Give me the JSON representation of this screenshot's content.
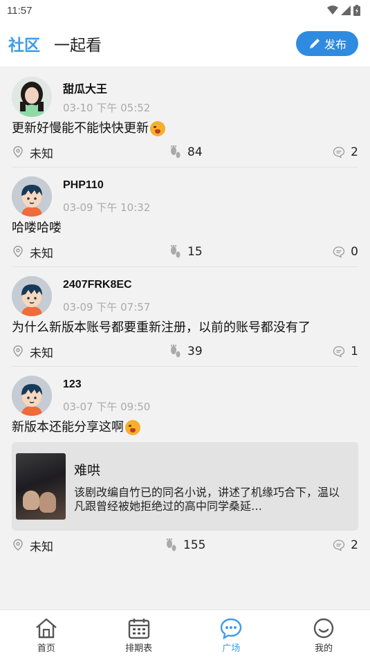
{
  "status_bar": {
    "time": "11:57"
  },
  "header": {
    "tabs": [
      {
        "label": "社区",
        "active": true
      },
      {
        "label": "一起看",
        "active": false
      }
    ],
    "publish_label": "发布"
  },
  "posts": [
    {
      "username": "甜瓜大王",
      "timestamp": "03-10 下午 05:52",
      "content": "更新好慢能不能快快更新",
      "location": "未知",
      "views": "84",
      "comments": "2"
    },
    {
      "username": "PHP110",
      "timestamp": "03-09 下午 10:32",
      "content": "哈喽哈喽",
      "location": "未知",
      "views": "15",
      "comments": "0"
    },
    {
      "username": "2407FRK8EC",
      "timestamp": "03-09 下午 07:57",
      "content": "为什么新版本账号都要重新注册，以前的账号都没有了",
      "location": "未知",
      "views": "39",
      "comments": "1"
    },
    {
      "username": "123",
      "timestamp": "03-07 下午 09:50",
      "content": "新版本还能分享这啊",
      "location": "未知",
      "views": "155",
      "comments": "2",
      "shared": {
        "title": "难哄",
        "description": "该剧改编自竹已的同名小说，讲述了机缘巧合下，温以凡跟曾经被她拒绝过的高中同学桑延…"
      }
    }
  ],
  "bottom_nav": [
    {
      "label": "首页",
      "icon": "home-icon",
      "active": false
    },
    {
      "label": "排期表",
      "icon": "calendar-icon",
      "active": false
    },
    {
      "label": "广场",
      "icon": "chat-icon",
      "active": true
    },
    {
      "label": "我的",
      "icon": "smile-icon",
      "active": false
    }
  ],
  "colors": {
    "accent": "#3d9be9",
    "publish_button": "#2f8be0",
    "background": "#f2f2f2"
  }
}
